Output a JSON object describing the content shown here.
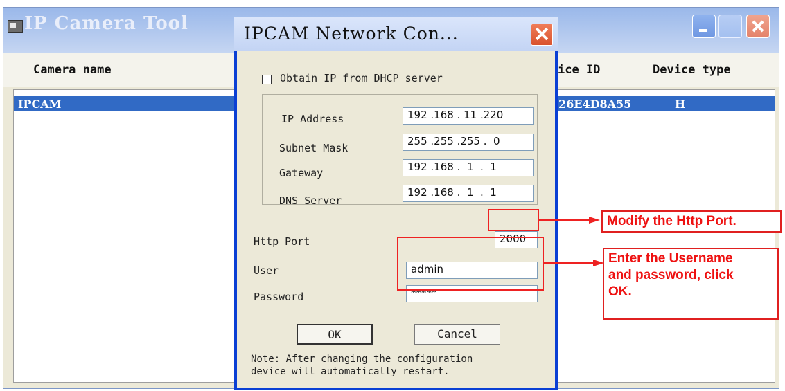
{
  "main_window": {
    "title": "IP Camera Tool",
    "columns": {
      "camera_name": "Camera name",
      "device_id": "ice ID",
      "device_type": "Device type"
    },
    "rows": [
      {
        "name": "IPCAM",
        "device_id": "26E4D8A55",
        "device_type": "H"
      }
    ]
  },
  "dialog": {
    "title": "IPCAM Network Con...",
    "dhcp_label": "Obtain IP from DHCP server",
    "dhcp_checked": false,
    "fields": {
      "ip_address": {
        "label": "IP Address",
        "value": "192 .168 . 11 .220"
      },
      "subnet_mask": {
        "label": "Subnet Mask",
        "value": "255 .255 .255 .  0"
      },
      "gateway": {
        "label": "Gateway",
        "value": "192 .168 .  1  .  1"
      },
      "dns_server": {
        "label": "DNS Server",
        "value": "192 .168 .  1  .  1"
      },
      "http_port": {
        "label": "Http Port",
        "value": "2000"
      },
      "user": {
        "label": "User",
        "value": "admin"
      },
      "password": {
        "label": "Password",
        "value": "*****"
      }
    },
    "ok_label": "OK",
    "cancel_label": "Cancel",
    "note_line1": "Note: After changing the configuration",
    "note_line2": "device will automatically restart."
  },
  "annotations": {
    "http_port_callout": "Modify the Http Port.",
    "credentials_callout_line1": "Enter the Username",
    "credentials_callout_line2": "and password, click",
    "credentials_callout_line3": "OK.",
    "annotation_color": "#ee1111"
  },
  "colors": {
    "selection": "#316ac5",
    "dialog_frame": "#0a3fd4",
    "window_bg": "#ece9d8"
  }
}
